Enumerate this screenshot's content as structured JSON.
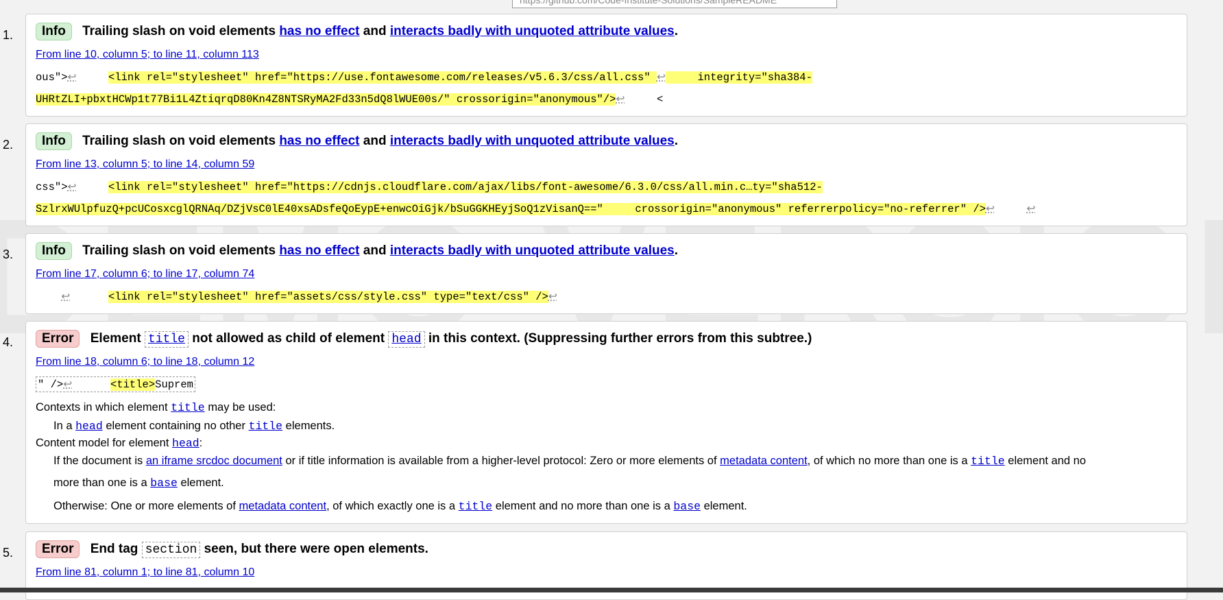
{
  "top_input": "https://github.com/Code-Institute-Solutions/SampleREADME",
  "watermark": "DEMO VERSION",
  "messages": [
    {
      "num": "1.",
      "badge": "Info",
      "title": "Trailing slash on void elements",
      "link1": "has no effect",
      "and": "and",
      "link2": "interacts badly with unquoted attribute values",
      "dot": ".",
      "location": "From line 10, column 5; to line 11, column 113",
      "ext1_pre": "ous\">",
      "ext1_hl": "<link rel=\"stylesheet\" href=\"https://use.fontawesome.com/releases/v5.6.3/css/all.css\" ",
      "ext1_hl2": "integrity=\"sha384-",
      "ext2_hl": "UHRtZLI+pbxtHCWp1t77Bi1L4ZtiqrqD80Kn4Z8NTSRyMA2Fd33n5dQ8lWUE00s/\" crossorigin=\"anonymous\"/>",
      "ext2_post": "<"
    },
    {
      "num": "2.",
      "badge": "Info",
      "title": "Trailing slash on void elements",
      "link1": "has no effect",
      "and": "and",
      "link2": "interacts badly with unquoted attribute values",
      "dot": ".",
      "location": "From line 13, column 5; to line 14, column 59",
      "ext1_pre": "css\">",
      "ext1_hl": "<link rel=\"stylesheet\" href=\"https://cdnjs.cloudflare.com/ajax/libs/font-awesome/6.3.0/css/all.min.c…ty=\"sha512-",
      "ext2_hl": "SzlrxWUlpfuzQ+pcUCosxcglQRNAq/DZjVsC0lE40xsADsfeQoEypE+enwcOiGjk/bSuGGKHEyjSoQ1zVisanQ==\"",
      "ext2_hl2": "crossorigin=\"anonymous\" referrerpolicy=\"no-referrer\" />"
    },
    {
      "num": "3.",
      "badge": "Info",
      "title": "Trailing slash on void elements",
      "link1": "has no effect",
      "and": "and",
      "link2": "interacts badly with unquoted attribute values",
      "dot": ".",
      "location": "From line 17, column 6; to line 17, column 74",
      "ext1_hl": "<link rel=\"stylesheet\" href=\"assets/css/style.css\" type=\"text/css\" />"
    },
    {
      "num": "4.",
      "badge": "Error",
      "t1": "Element",
      "code1": "title",
      "t2": "not allowed as child of element",
      "code2": "head",
      "t3": "in this context. (Suppressing further errors from this subtree.)",
      "location": "From line 18, column 6; to line 18, column 12",
      "ext_pre": "\" />",
      "ext_hl": "<title>",
      "ext_post": "Suprem",
      "contexts_a": "Contexts in which element",
      "contexts_code": "title",
      "contexts_b": "may be used:",
      "ctx_item_a": "In a",
      "ctx_item_code1": "head",
      "ctx_item_b": "element containing no other",
      "ctx_item_code2": "title",
      "ctx_item_c": "elements.",
      "model_a": "Content model for element",
      "model_code": "head",
      "model_b": ":",
      "m1_a": "If the document is",
      "m1_link": "an iframe srcdoc document",
      "m1_b": "or if title information is available from a higher-level protocol: Zero or more elements of",
      "m1_link2": "metadata content",
      "m1_c": ", of which no more than one is a",
      "m1_code": "title",
      "m1_d": "element and no",
      "m1_e": "more than one is a",
      "m1_code2": "base",
      "m1_f": "element.",
      "m2_a": "Otherwise: One or more elements of",
      "m2_link": "metadata content",
      "m2_b": ", of which exactly one is a",
      "m2_code": "title",
      "m2_c": "element and no more than one is a",
      "m2_code2": "base",
      "m2_d": "element."
    },
    {
      "num": "5.",
      "badge": "Error",
      "t1": "End tag",
      "code1": "section",
      "t2": "seen, but there were open elements.",
      "location": "From line 81, column 1; to line 81, column 10"
    }
  ]
}
